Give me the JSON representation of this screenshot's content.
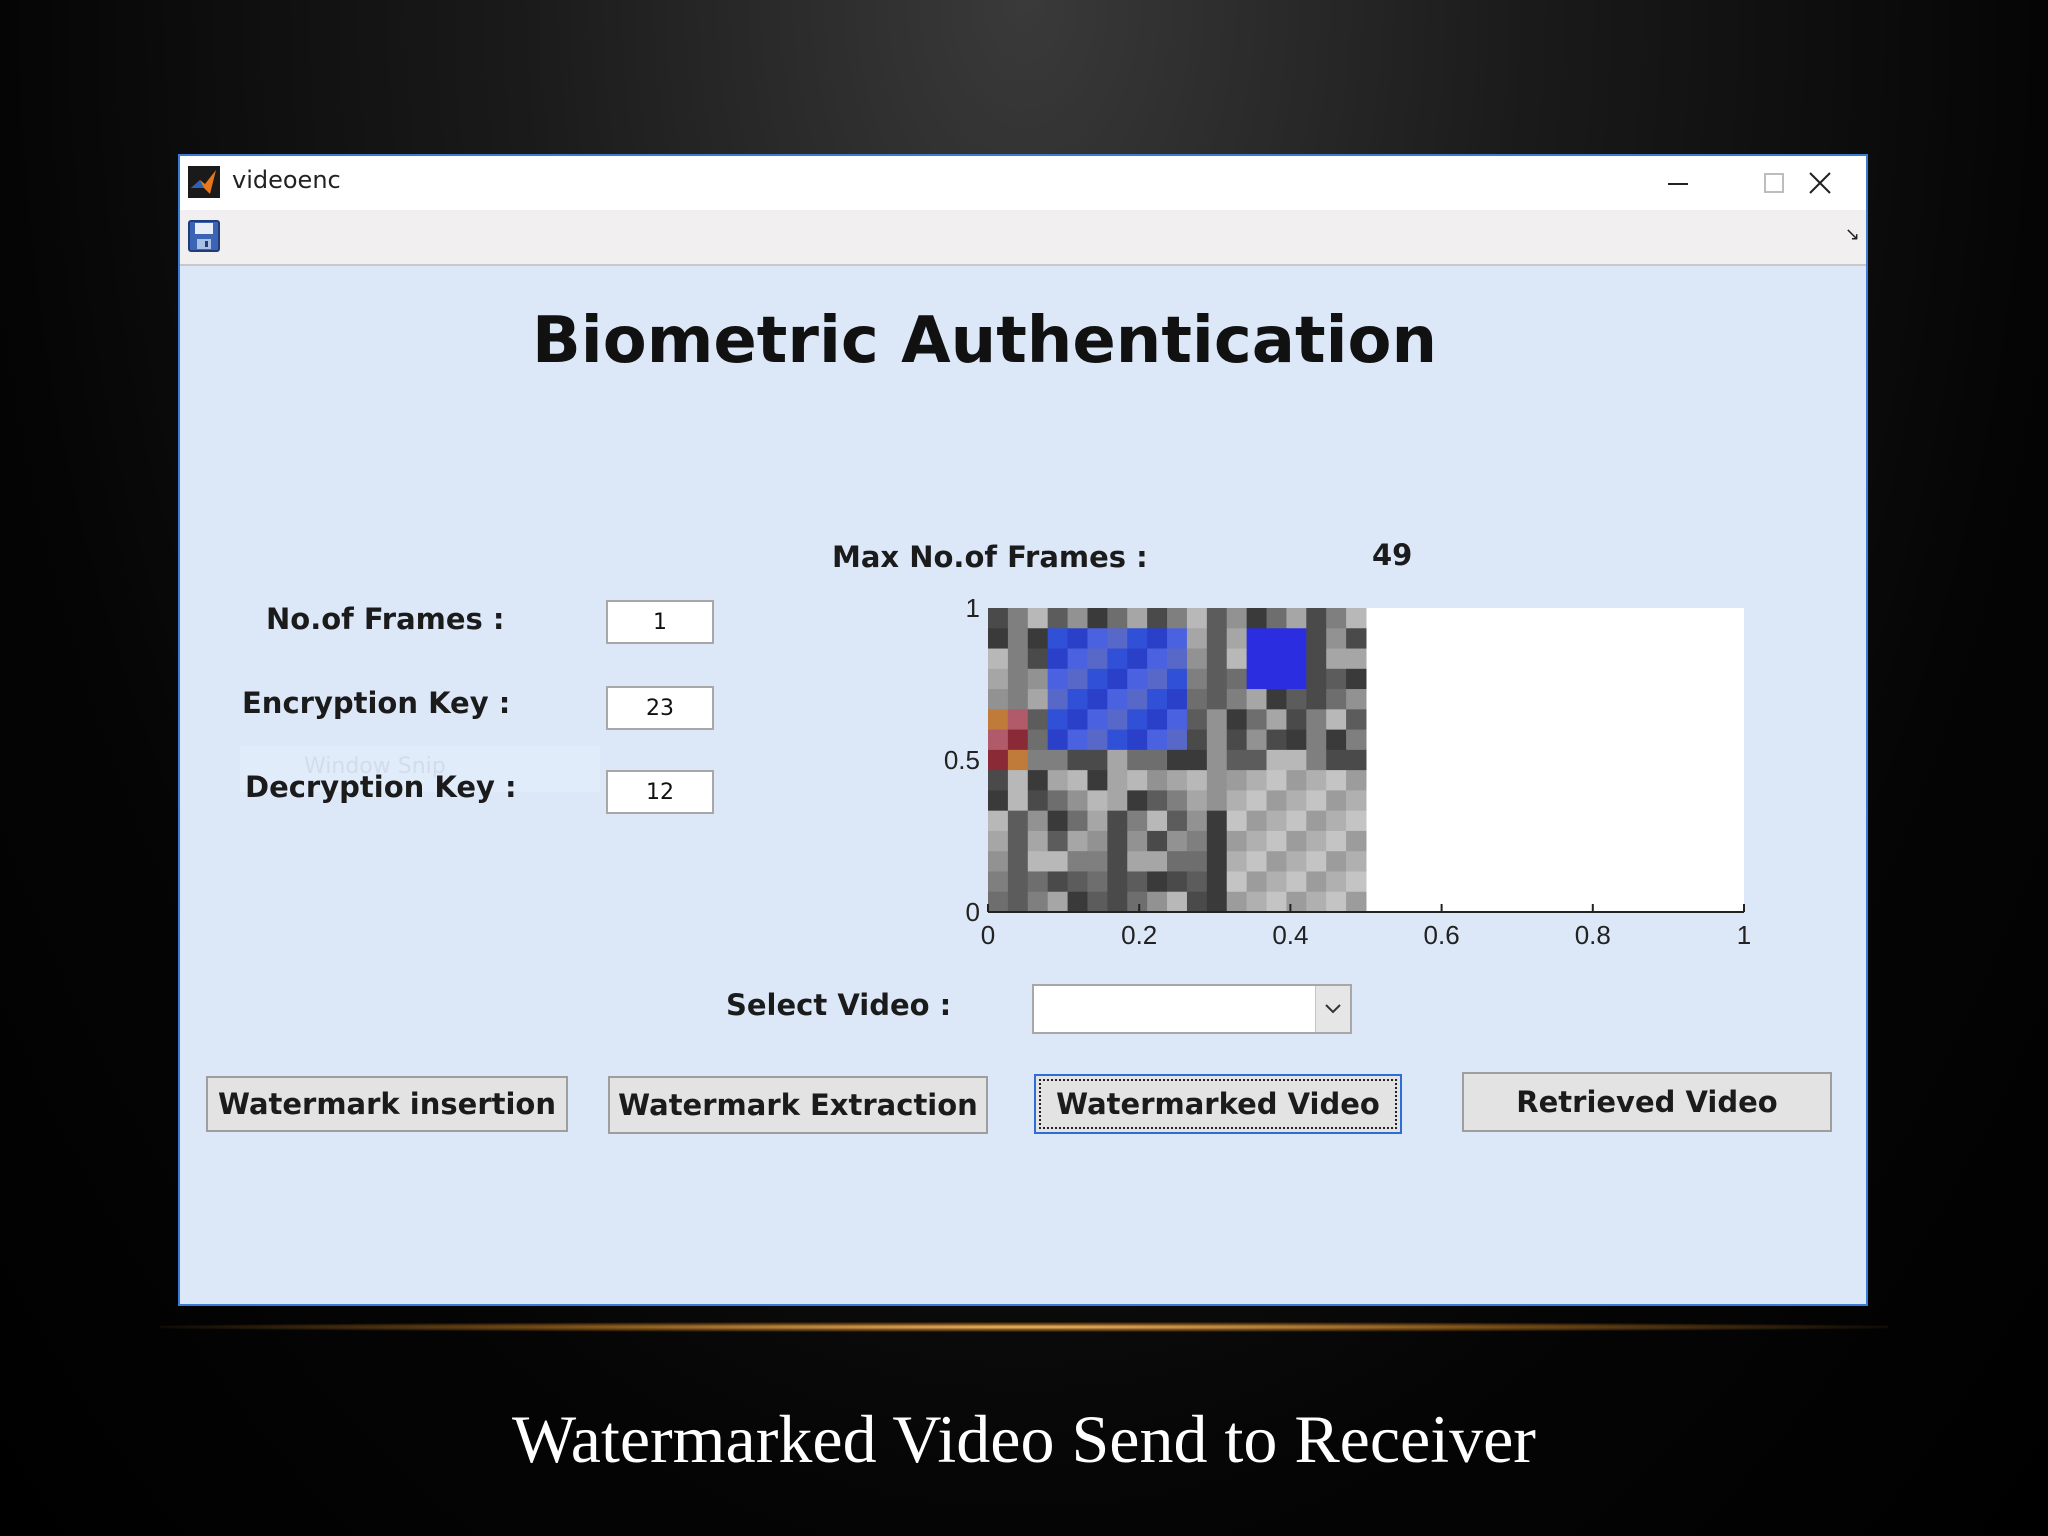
{
  "window": {
    "title": "videoenc",
    "controls": {
      "minimize": "minimize-icon",
      "maximize": "maximize-icon",
      "close": "close-icon"
    }
  },
  "toolbar": {
    "save_icon": "save-icon",
    "dock_icon": "dock-arrow-icon"
  },
  "heading": "Biometric Authentication",
  "max_frames": {
    "label": "Max No.of Frames :",
    "value": "49"
  },
  "fields": {
    "frames": {
      "label": "No.of Frames :",
      "value": "1"
    },
    "encryption": {
      "label": "Encryption Key :",
      "value": "23"
    },
    "decryption": {
      "label": "Decryption Key :",
      "value": "12"
    }
  },
  "plot": {
    "x_ticks": [
      "0",
      "0.2",
      "0.4",
      "0.6",
      "0.8",
      "1"
    ],
    "y_ticks": [
      "0",
      "0.5",
      "1"
    ],
    "image_extent_x": 0.5
  },
  "select_video": {
    "label": "Select Video :",
    "value": ""
  },
  "buttons": {
    "insertion": "Watermark insertion",
    "extraction": "Watermark Extraction",
    "watermarked": "Watermarked Video",
    "retrieved": "Retrieved Video"
  },
  "overlay_text": "Window Snip",
  "caption": "Watermarked Video Send to Receiver"
}
